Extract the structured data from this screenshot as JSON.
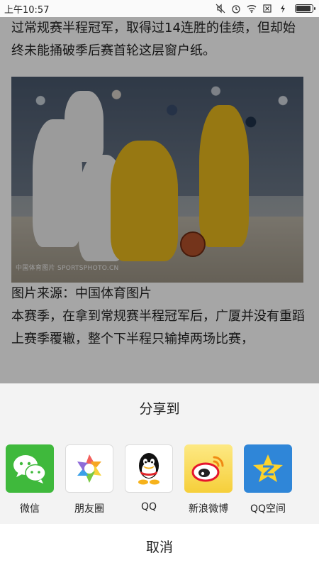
{
  "status_bar": {
    "time": "上午10:57",
    "icons": [
      "mute-icon",
      "alarm-icon",
      "wifi-icon",
      "sim-x-icon",
      "charging-icon",
      "battery-icon"
    ],
    "battery_level": 0.84
  },
  "article": {
    "para1": "过常规赛半程冠军，取得过14连胜的佳绩，但却始终未能捅破季后赛首轮这层窗户纸。",
    "photo_watermark": "中国体育图片 SPORTSPHOTO.CN",
    "para2": "图片来源：中国体育图片",
    "para3": "本赛季，在拿到常规赛半程冠军后，广厦并没有重蹈上赛季覆辙，整个下半程只输掉两场比赛，"
  },
  "share_sheet": {
    "title": "分享到",
    "options": [
      {
        "label": "微信",
        "icon": "wechat-icon",
        "color": "#3fb93c"
      },
      {
        "label": "朋友圈",
        "icon": "moments-icon",
        "color": "#ffffff"
      },
      {
        "label": "QQ",
        "icon": "qq-icon",
        "color": "#ffffff"
      },
      {
        "label": "新浪微博",
        "icon": "weibo-icon",
        "color": "#f6cf3a"
      },
      {
        "label": "QQ空间",
        "icon": "qzone-icon",
        "color": "#2f86d8"
      }
    ],
    "cancel_label": "取消"
  }
}
